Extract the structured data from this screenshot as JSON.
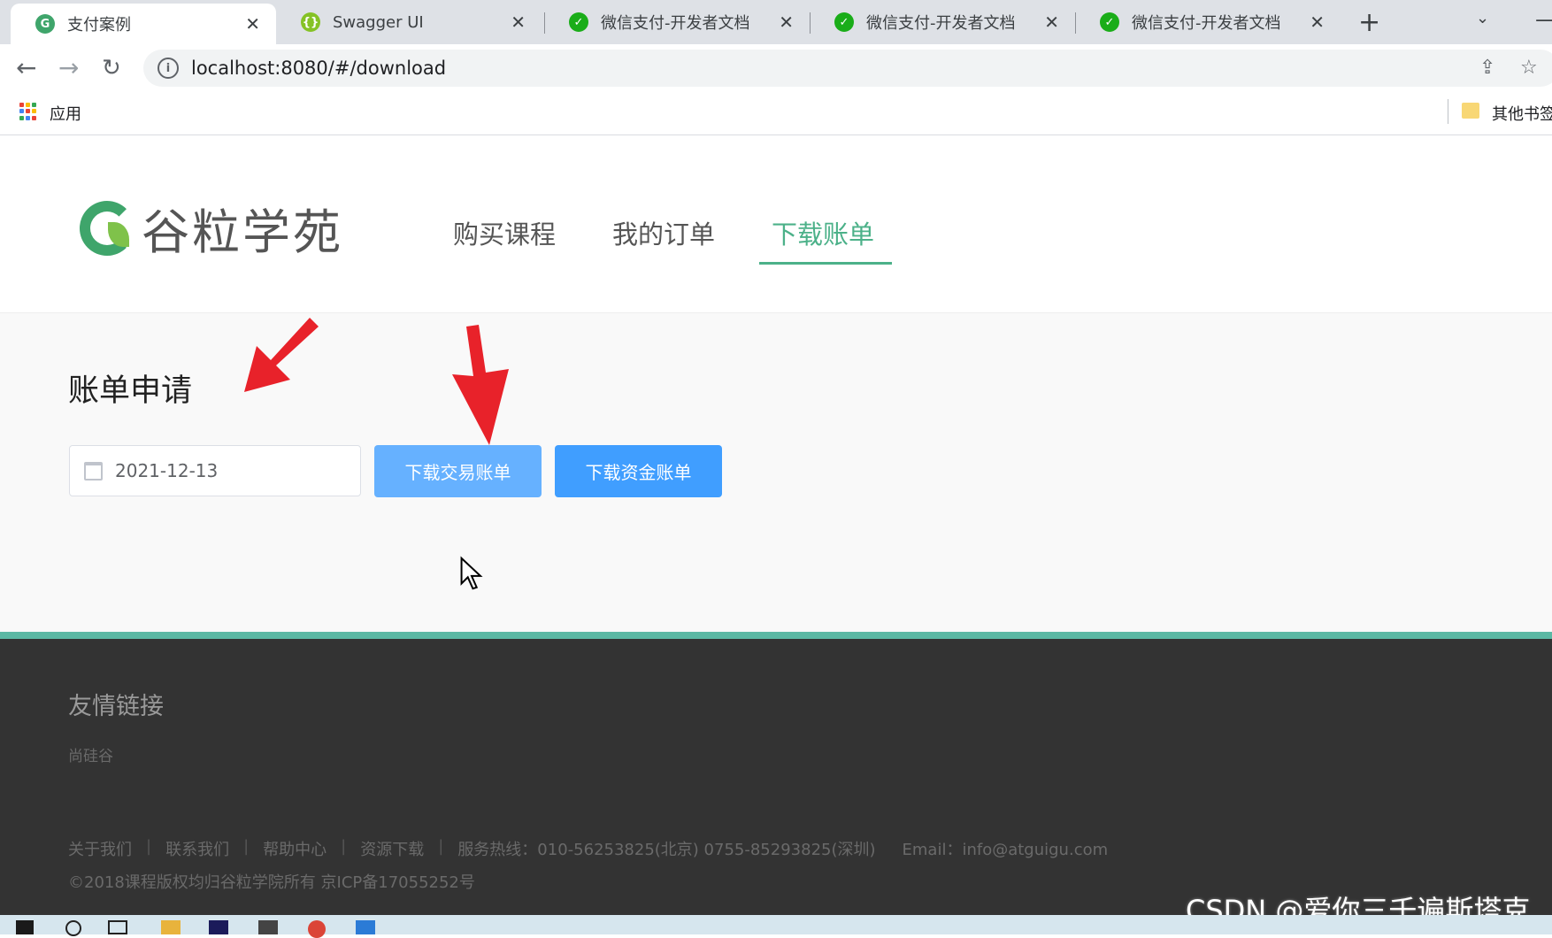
{
  "browser": {
    "tabs": [
      {
        "title": "支付案例",
        "icon": "gugu-logo-icon",
        "active": true
      },
      {
        "title": "Swagger UI",
        "icon": "swagger-icon",
        "active": false
      },
      {
        "title": "微信支付-开发者文档",
        "icon": "wechat-pay-icon",
        "active": false
      },
      {
        "title": "微信支付-开发者文档",
        "icon": "wechat-pay-icon",
        "active": false
      },
      {
        "title": "微信支付-开发者文档",
        "icon": "wechat-pay-icon",
        "active": false
      }
    ],
    "close_glyph": "✕",
    "new_tab_glyph": "+",
    "tab_menu_glyph": "⌄",
    "min_glyph": "—",
    "address": "localhost:8080/#/download",
    "info_glyph": "i",
    "bookmarks": {
      "apps_label": "应用",
      "other_label": "其他书签"
    }
  },
  "site": {
    "logo_text": "谷粒学苑",
    "nav": [
      {
        "label": "购买课程",
        "active": false
      },
      {
        "label": "我的订单",
        "active": false
      },
      {
        "label": "下载账单",
        "active": true
      }
    ],
    "accent_color": "#4cb189"
  },
  "bill": {
    "title": "账单申请",
    "date_value": "2021-12-13",
    "trade_button": "下载交易账单",
    "fund_button": "下载资金账单"
  },
  "footer": {
    "title": "友情链接",
    "friend_link": "尚硅谷",
    "links": [
      "关于我们",
      "联系我们",
      "帮助中心",
      "资源下载"
    ],
    "hotline": "服务热线：010-56253825(北京) 0755-85293825(深圳)",
    "email": "Email：info@atguigu.com",
    "copyright": "©2018课程版权均归谷粒学院所有 京ICP备17055252号"
  },
  "watermark": "CSDN @爱你三千遍斯塔克",
  "annotation_color": "#e8222a"
}
